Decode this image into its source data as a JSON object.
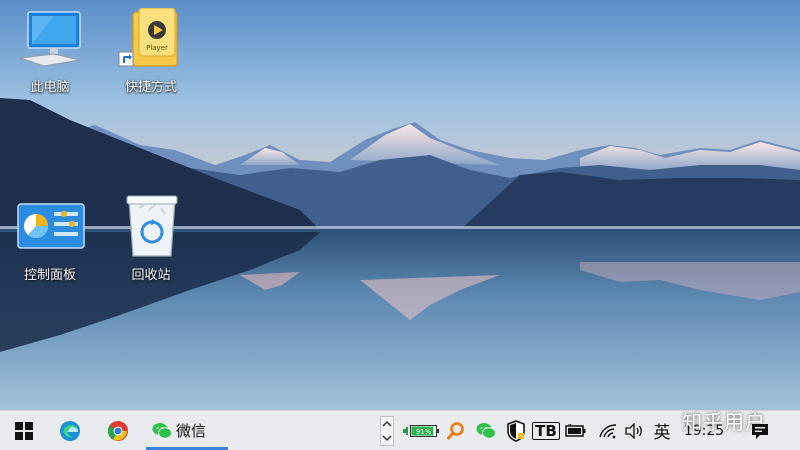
{
  "desktop": {
    "icons": [
      {
        "label": "此电脑",
        "icon": "computer-icon"
      },
      {
        "label": "快捷方式",
        "icon": "video-player-shortcut-icon"
      },
      {
        "label": "控制面板",
        "icon": "control-panel-icon"
      },
      {
        "label": "回收站",
        "icon": "recycle-bin-icon"
      }
    ]
  },
  "taskbar": {
    "start_icon": "windows-logo-icon",
    "pinned": [
      {
        "icon": "edge-icon"
      },
      {
        "icon": "chrome-icon"
      }
    ],
    "running_app": {
      "label": "微信",
      "icon": "wechat-icon"
    },
    "tray": {
      "overflow_icon": "chevron-up-icon",
      "battery_text": "91%",
      "battery_percent": 91,
      "search_icon": "magnifier-icon",
      "wechat_tray_icon": "wechat-icon",
      "security_icon": "shield-icon",
      "tb_icon": "TB",
      "wifi_icon": "wifi-icon",
      "volume_icon": "speaker-icon",
      "ime_label": "英",
      "clock_time": "19:25",
      "notification_icon": "notification-icon"
    }
  },
  "watermark": "知乎用户",
  "colors": {
    "taskbar_bg": "#e9ebef",
    "accent": "#3c82dc",
    "battery_green": "#27b24a"
  }
}
